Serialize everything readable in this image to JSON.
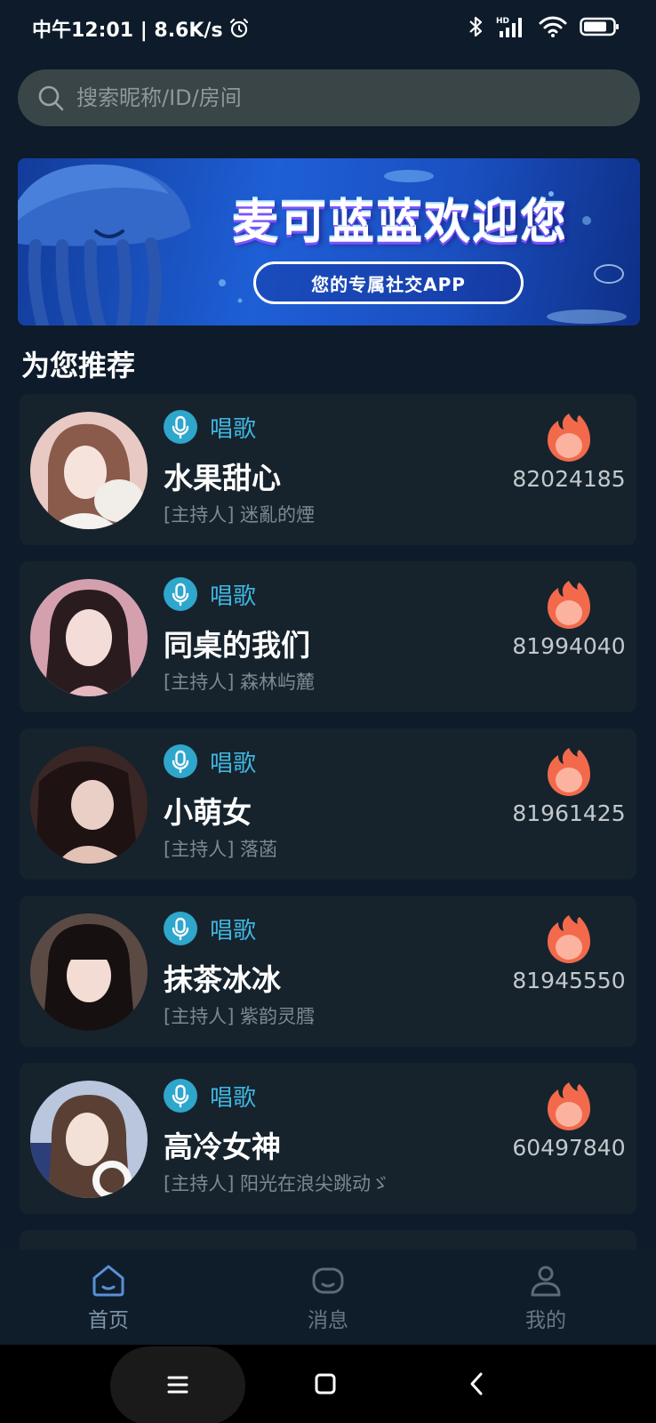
{
  "status_bar": {
    "time": "中午12:01 | 8.6K/s",
    "icons": [
      "alarm-icon",
      "bluetooth-icon",
      "hd-signal-icon",
      "wifi-icon",
      "battery-icon"
    ]
  },
  "search": {
    "placeholder": "搜索昵称/ID/房间",
    "icon": "search-icon"
  },
  "banner": {
    "title": "麦可蓝蓝欢迎您",
    "subtitle": "您的专属社交APP"
  },
  "section": {
    "title": "为您推荐"
  },
  "rooms": [
    {
      "category": "唱歌",
      "name": "水果甜心",
      "host": "[主持人] 迷亂的煙",
      "heat": "82024185",
      "avatar_color": "#e8c9c4"
    },
    {
      "category": "唱歌",
      "name": "同桌的我们",
      "host": "[主持人] 森林屿麓",
      "heat": "81994040",
      "avatar_color": "#c98a98"
    },
    {
      "category": "唱歌",
      "name": "小萌女",
      "host": "[主持人] 落菡",
      "heat": "81961425",
      "avatar_color": "#5a3a36"
    },
    {
      "category": "唱歌",
      "name": "抹茶冰冰",
      "host": "[主持人] 紫韵灵膤",
      "heat": "81945550",
      "avatar_color": "#3e3331"
    },
    {
      "category": "唱歌",
      "name": "高冷女神",
      "host": "[主持人] 阳光在浪尖跳动ゞ",
      "heat": "60497840",
      "avatar_color": "#b9c6dd"
    }
  ],
  "bottom_nav": [
    {
      "label": "首页",
      "icon": "home-icon",
      "active": true
    },
    {
      "label": "消息",
      "icon": "message-icon",
      "active": false
    },
    {
      "label": "我的",
      "icon": "profile-icon",
      "active": false
    }
  ],
  "colors": {
    "background": "#0d1b2a",
    "card": "#16232c",
    "accent": "#3fb6e0",
    "heat": "#f26a4b"
  }
}
